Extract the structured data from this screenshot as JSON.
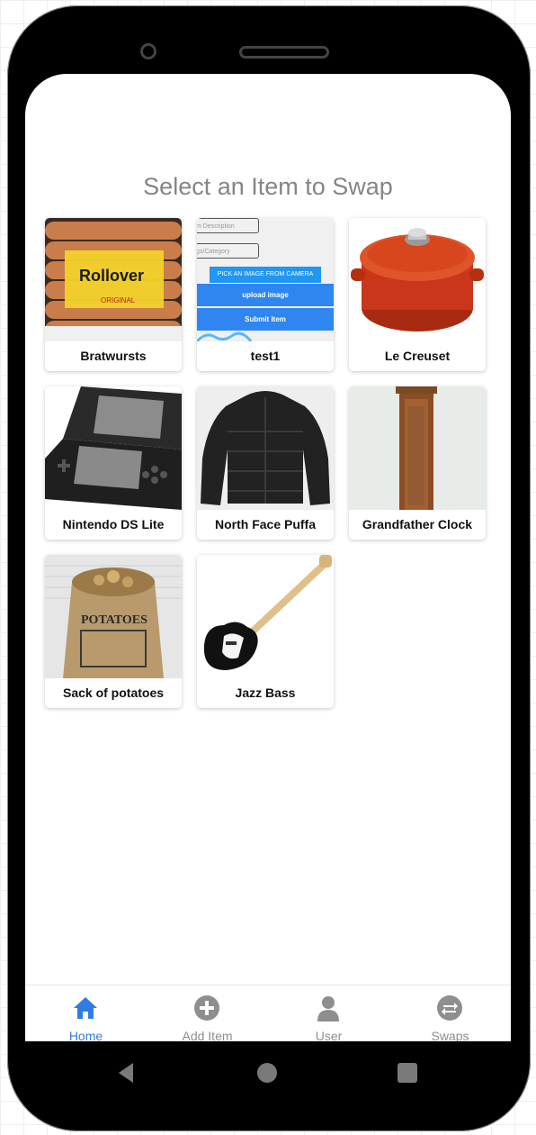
{
  "page_title": "Select an Item to Swap",
  "items": [
    {
      "name": "Bratwursts",
      "image": "bratwurst-package-image"
    },
    {
      "name": "test1",
      "image": "form-screenshot-image",
      "form": {
        "description_placeholder": "m Description",
        "category_placeholder": "gs/Category",
        "pick_label": "PICK AN IMAGE FROM CAMERA ROLL",
        "upload_label": "upload image",
        "submit_label": "Submit Item"
      }
    },
    {
      "name": "Le Creuset",
      "image": "dutch-oven-image"
    },
    {
      "name": "Nintendo DS Lite",
      "image": "nintendo-ds-image"
    },
    {
      "name": "North Face Puffa",
      "image": "puffer-jacket-image"
    },
    {
      "name": "Grandfather Clock",
      "image": "grandfather-clock-image"
    },
    {
      "name": "Sack of potatoes",
      "image": "potato-sack-image"
    },
    {
      "name": "Jazz Bass",
      "image": "bass-guitar-image"
    }
  ],
  "tabs": [
    {
      "label": "Home",
      "icon": "home-icon",
      "active": true
    },
    {
      "label": "Add Item",
      "icon": "plus-circle-icon",
      "active": false
    },
    {
      "label": "User",
      "icon": "user-icon",
      "active": false
    },
    {
      "label": "Swaps",
      "icon": "swap-arrows-icon",
      "active": false
    }
  ],
  "colors": {
    "accent": "#2f7de1",
    "tab_inactive": "#8e8e8e",
    "title": "#858585"
  },
  "image_text": {
    "brand": "Rollover",
    "sub": "ORIGINAL",
    "potatoes": "POTATOES"
  }
}
